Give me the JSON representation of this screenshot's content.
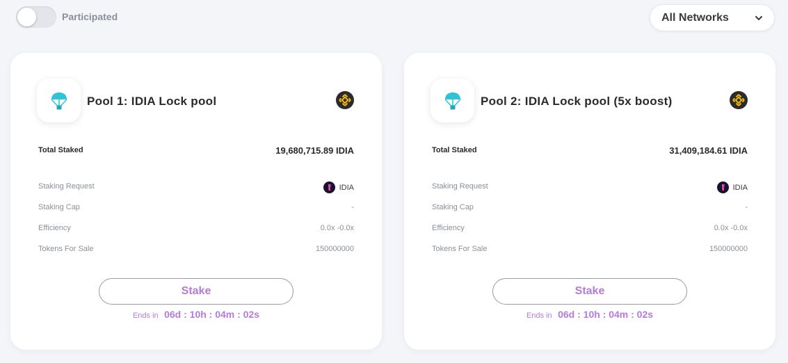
{
  "filter": {
    "participated_label": "Participated",
    "participated_on": false,
    "network_select_value": "All Networks"
  },
  "pools": [
    {
      "title": "Pool 1: IDIA Lock pool",
      "total_staked_label": "Total Staked",
      "total_staked_value": "19,680,715.89 IDIA",
      "staking_request_label": "Staking Request",
      "staking_request_value": "IDIA",
      "staking_cap_label": "Staking Cap",
      "staking_cap_value": "-",
      "efficiency_label": "Efficiency",
      "efficiency_value": "0.0x -0.0x",
      "tokens_for_sale_label": "Tokens For Sale",
      "tokens_for_sale_value": "150000000",
      "stake_button_label": "Stake",
      "ends_in_label": "Ends in",
      "countdown": "06d : 10h : 04m : 02s"
    },
    {
      "title": "Pool 2: IDIA Lock pool (5x boost)",
      "total_staked_label": "Total Staked",
      "total_staked_value": "31,409,184.61 IDIA",
      "staking_request_label": "Staking Request",
      "staking_request_value": "IDIA",
      "staking_cap_label": "Staking Cap",
      "staking_cap_value": "-",
      "efficiency_label": "Efficiency",
      "efficiency_value": "0.0x -0.0x",
      "tokens_for_sale_label": "Tokens For Sale",
      "tokens_for_sale_value": "150000000",
      "stake_button_label": "Stake",
      "ends_in_label": "Ends in",
      "countdown": "06d : 10h : 04m : 02s"
    }
  ],
  "icons": {
    "pool_logo": "parachute-icon",
    "chain_badge": "bnb-chain-icon",
    "token_icon": "idia-token-icon",
    "dropdown": "chevron-down-icon"
  },
  "colors": {
    "accent": "#b57bd8",
    "logo_cyan": "#2ec4d8",
    "bnb_gold": "#f0b90b",
    "bnb_bg": "#2b2b2b",
    "background": "#f3f5f9"
  }
}
